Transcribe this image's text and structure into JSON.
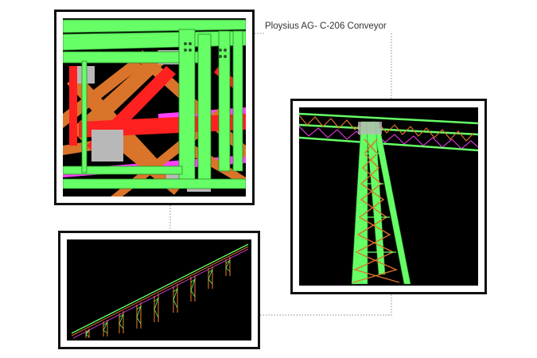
{
  "caption": {
    "title": "Ploysius AG- C-206 Conveyor"
  },
  "colors": {
    "steel_green": "#66ff66",
    "brace_orange": "#d9742a",
    "member_red": "#ff2020",
    "accent_magenta": "#ff40ff",
    "plate_gray": "#b8b8b8",
    "background": "#000000",
    "frame_border": "#111111",
    "leader_line": "#888888"
  },
  "images": [
    {
      "name": "detail-connection-view"
    },
    {
      "name": "tower-support-view"
    },
    {
      "name": "conveyor-overview-view"
    }
  ]
}
